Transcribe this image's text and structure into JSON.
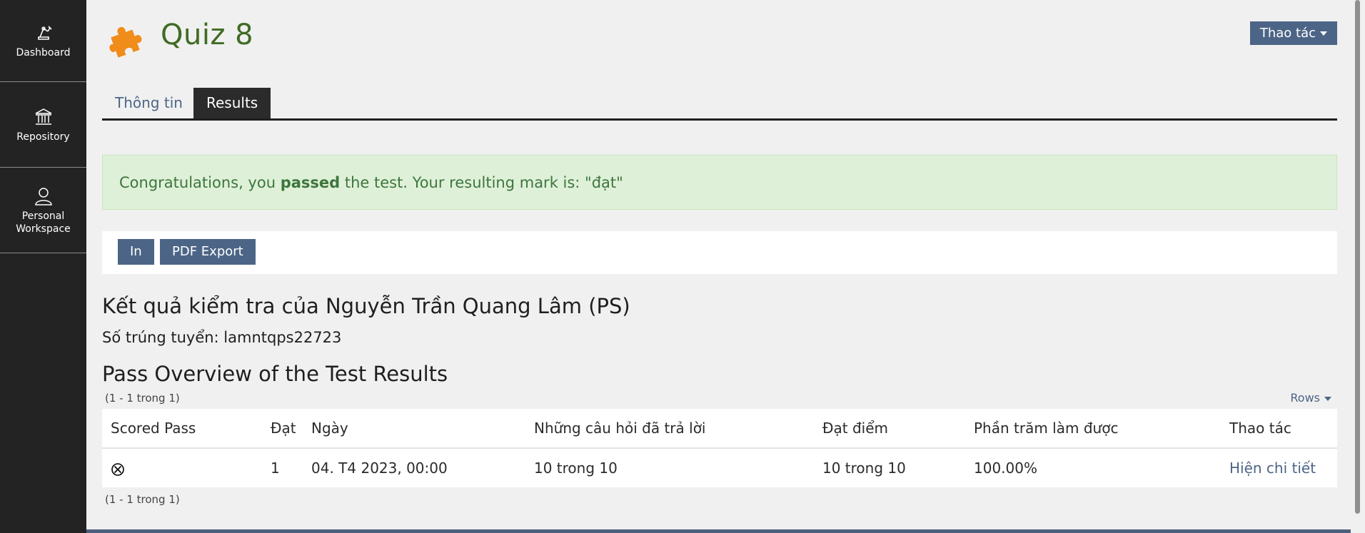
{
  "sidebar": {
    "items": [
      {
        "label": "Dashboard",
        "icon": "dashboard-icon"
      },
      {
        "label": "Repository",
        "icon": "repository-icon"
      },
      {
        "label": "Personal\nWorkspace",
        "icon": "user-icon"
      }
    ]
  },
  "header": {
    "title": "Quiz 8",
    "actions_label": "Thao tác"
  },
  "tabs": [
    {
      "label": "Thông tin",
      "active": false
    },
    {
      "label": "Results",
      "active": true
    }
  ],
  "alert": {
    "prefix": "Congratulations, you ",
    "bold": "passed",
    "suffix": " the test. Your resulting mark is: \"đạt\""
  },
  "toolbar": {
    "print_label": "In",
    "pdf_label": "PDF Export"
  },
  "result": {
    "heading": "Kết quả kiểm tra của Nguyễn Trần Quang Lâm (PS)",
    "registration": "Số trúng tuyển: lamntqps22723"
  },
  "overview": {
    "heading": "Pass Overview of the Test Results",
    "count_top": "(1 - 1 trong 1)",
    "count_bottom": "(1 - 1 trong 1)",
    "rows_label": "Rows",
    "columns": [
      "Scored Pass",
      "Đạt",
      "Ngày",
      "Những câu hỏi đã trả lời",
      "Đạt điểm",
      "Phần trăm làm được",
      "Thao tác"
    ],
    "rows": [
      {
        "scored_pass_icon": "circled-x-icon",
        "pass": "1",
        "date": "04. T4 2023, 00:00",
        "answered": "10 trong 10",
        "points": "10 trong 10",
        "percent": "100.00%",
        "action": "Hiện chi tiết"
      }
    ]
  },
  "colors": {
    "sidebar_bg": "#232323",
    "accent": "#4c6586",
    "title_green": "#3f6b24",
    "alert_bg": "#dff0d8",
    "alert_text": "#3c763d",
    "puzzle_orange": "#f08c1a"
  }
}
